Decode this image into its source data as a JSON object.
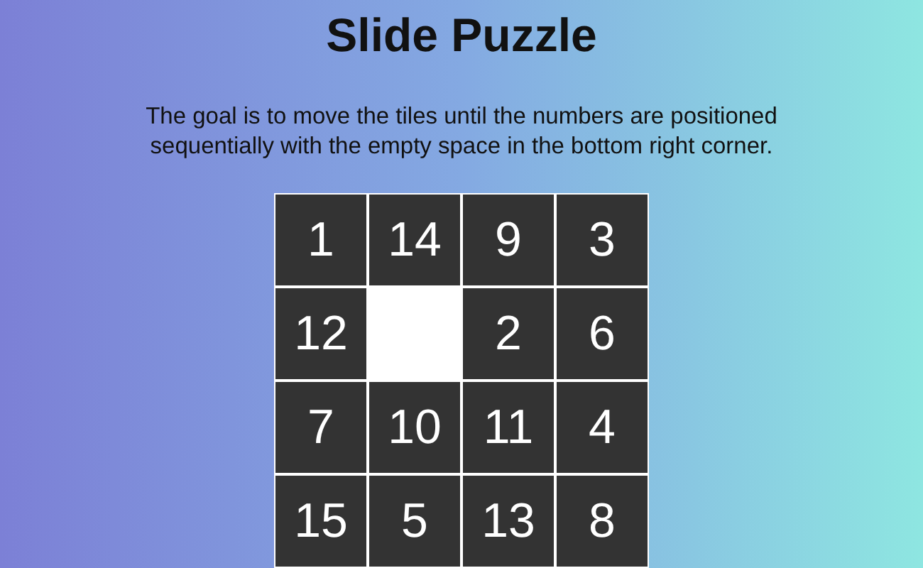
{
  "title": "Slide Puzzle",
  "description": "The goal is to move the tiles until the numbers are positioned sequentially with the empty space in the bottom right corner.",
  "tiles": [
    {
      "kind": "number",
      "label": "1"
    },
    {
      "kind": "number",
      "label": "14"
    },
    {
      "kind": "number",
      "label": "9"
    },
    {
      "kind": "number",
      "label": "3"
    },
    {
      "kind": "number",
      "label": "12"
    },
    {
      "kind": "empty"
    },
    {
      "kind": "number",
      "label": "2"
    },
    {
      "kind": "number",
      "label": "6"
    },
    {
      "kind": "number",
      "label": "7"
    },
    {
      "kind": "number",
      "label": "10"
    },
    {
      "kind": "number",
      "label": "11"
    },
    {
      "kind": "number",
      "label": "4"
    },
    {
      "kind": "number",
      "label": "15"
    },
    {
      "kind": "number",
      "label": "5"
    },
    {
      "kind": "number",
      "label": "13"
    },
    {
      "kind": "number",
      "label": "8"
    }
  ]
}
